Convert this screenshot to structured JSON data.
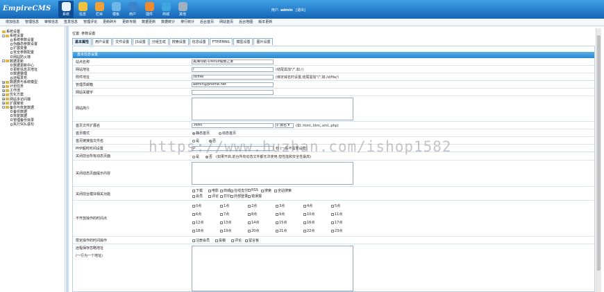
{
  "header": {
    "logo": "EmpireCMS",
    "nav": [
      "系统",
      "信息",
      "栏目",
      "模板",
      "用户",
      "插件",
      "商城",
      "其他"
    ],
    "user_label": "用户:",
    "user_name": "admin",
    "logout": "[退出]"
  },
  "submenu": [
    "增加信息",
    "管理信息",
    "审核信息",
    "签发信息",
    "管理评论",
    "更新碎片",
    "更新专题",
    "数据更新",
    "数据统计",
    "排行统计",
    "后台首页",
    "网站首页",
    "后台地图",
    "版本更新"
  ],
  "tree": [
    {
      "label": "系统设置",
      "level": 1,
      "type": "root"
    },
    {
      "label": "系统设置",
      "level": 1,
      "type": "open"
    },
    {
      "label": "系统参数设置",
      "level": 2
    },
    {
      "label": "伪静态参数设置",
      "level": 2
    },
    {
      "label": "扩展变量",
      "level": 2
    },
    {
      "label": "安全参数配置",
      "level": 2
    },
    {
      "label": "网站防火墙",
      "level": 2
    },
    {
      "label": "数据更新",
      "level": 1,
      "type": "open"
    },
    {
      "label": "数据更新中心",
      "level": 2
    },
    {
      "label": "更新信息页地址",
      "level": 2
    },
    {
      "label": "数据整理",
      "level": 2
    },
    {
      "label": "远程发布",
      "level": 2
    },
    {
      "label": "数据表与系统模型",
      "level": 1,
      "type": "closed"
    },
    {
      "label": "计划任务",
      "level": 1,
      "type": "closed"
    },
    {
      "label": "工作流",
      "level": 1,
      "type": "closed"
    },
    {
      "label": "优化方案",
      "level": 1,
      "type": "closed"
    },
    {
      "label": "网站多访问端",
      "level": 1,
      "type": "closed"
    },
    {
      "label": "扩展菜单",
      "level": 1,
      "type": "closed"
    },
    {
      "label": "备份与恢复数据",
      "level": 1,
      "type": "open"
    },
    {
      "label": "备份数据",
      "level": 2
    },
    {
      "label": "恢复数据",
      "level": 2
    },
    {
      "label": "管理备份目录",
      "level": 2
    },
    {
      "label": "执行SQL语句",
      "level": 2
    }
  ],
  "breadcrumb": {
    "prefix": "位置:",
    "current": "参数设置"
  },
  "tabs": [
    "基本属性",
    "用户设置",
    "文件设置",
    "JS设置",
    "分组生成",
    "搜索设置",
    "信息设置",
    "FTP/EMAIL",
    "模型设置",
    "图片设置"
  ],
  "panel_title": "基本信息设置",
  "form": {
    "site_name_label": "站点名称",
    "site_name_value": "黑海导航-Discuz模板之家",
    "site_url_label": "网站地址",
    "site_url_value": "/",
    "site_url_hint": "(结尾需加\"/\",如:/)",
    "attach_label": "附件地址",
    "attach_value": "/d/file/",
    "attach_hint": "(绑定域名时设置,结尾需加\"/\",如:/d/file/)",
    "email_label": "管理员邮箱",
    "email_value": "admin@phome.net",
    "keywords_label": "网站关键字",
    "intro_label": "网站简介",
    "ext_label": "首页文件扩展名",
    "ext_value": ".html",
    "ext_select": "扩展名",
    "ext_hint": "(如:.html,.htm,.xml,.php)",
    "mode_label": "首页模式",
    "mode_options": [
      "静态首页",
      "动态首页"
    ],
    "link_label": "首页链接指文件名",
    "link_options": [
      "是",
      "否"
    ],
    "php_label": "PHP超时时间设置",
    "php_value": "0",
    "php_hint": "秒 (一般不需要设置)",
    "close_label": "关闭前台所有动态页面",
    "close_options": [
      "是",
      "否"
    ],
    "close_hint": "(如果开启,前台所有动态文件都无法使用,但性能和安全性最高)",
    "close_msg_label": "关闭动态页面提示内容",
    "close_mods_label": "关闭前台模块相关功能",
    "close_mods": [
      "下载",
      "电影",
      "商城",
      "在线支付",
      "RSS",
      "搜索",
      "全站搜索",
      "会员",
      "评论",
      "打印",
      "外部登录",
      "错误报"
    ],
    "hours_label": "不开放操作的时间点",
    "hours": [
      "0点",
      "1点",
      "2点",
      "3点",
      "4点",
      "5点",
      "6点",
      "7点",
      "8点",
      "9点",
      "10点",
      "11点",
      "12点",
      "13点",
      "14点",
      "15点",
      "16点",
      "17点",
      "18点",
      "19点",
      "20点",
      "21点",
      "22点",
      "23点"
    ],
    "limit_label": "限定操作的时间操作",
    "limit_ops": [
      "注册会员",
      "投稿",
      "评论",
      "留言板"
    ],
    "save_label": "远程保存忽略地址",
    "save_hint": "(一行为一个地址)"
  },
  "watermark": "https://www.huzhan.com/ishop1582",
  "colors": {
    "header": "#1f79cc",
    "panel_head": "#3a96dc",
    "active_tab": "#e6f0fa"
  }
}
